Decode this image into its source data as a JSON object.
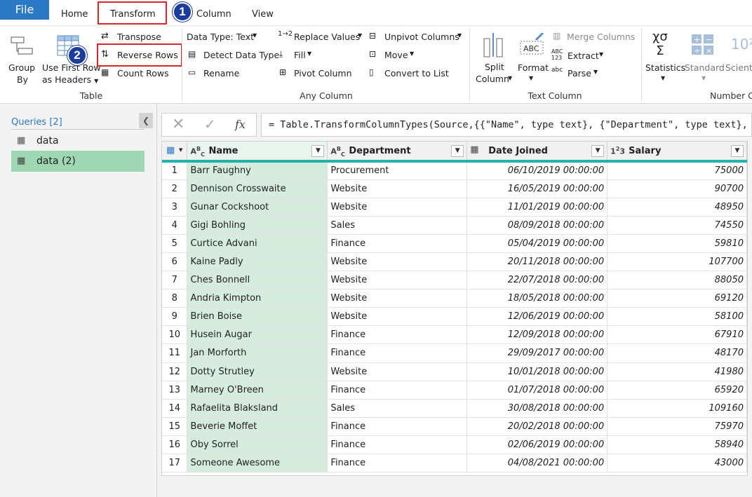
{
  "tabs": {
    "file": "File",
    "home": "Home",
    "transform": "Transform",
    "column": "Column",
    "view": "View"
  },
  "badges": {
    "one": "1",
    "two": "2"
  },
  "ribbon": {
    "group_by_1": "Group",
    "group_by_2": "By",
    "use_first_row_1": "Use First Row",
    "use_first_row_2": "as Headers",
    "transpose": "Transpose",
    "reverse_rows": "Reverse Rows",
    "count_rows": "Count Rows",
    "group_table": "Table",
    "data_type": "Data Type: Text",
    "detect_data_type": "Detect Data Type",
    "rename": "Rename",
    "replace_values": "Replace Values",
    "fill": "Fill",
    "pivot_column": "Pivot Column",
    "unpivot_columns": "Unpivot Columns",
    "move": "Move",
    "convert_to_list": "Convert to List",
    "group_any_column": "Any Column",
    "split_column_1": "Split",
    "split_column_2": "Column",
    "format": "Format",
    "merge_columns": "Merge Columns",
    "extract": "Extract",
    "parse": "Parse",
    "group_text_column": "Text Column",
    "statistics": "Statistics",
    "standard": "Standard",
    "scientific": "Scienti",
    "group_number_column": "Number C"
  },
  "queries": {
    "header": "Queries [2]",
    "items": [
      "data",
      "data (2)"
    ]
  },
  "formula": {
    "fx": "fx",
    "text": "= Table.TransformColumnTypes(Source,{{\"Name\", type text}, {\"Department\", type text},"
  },
  "columns": [
    "Name",
    "Department",
    "Date Joined",
    "Salary"
  ],
  "column_types": [
    "ABC",
    "ABC",
    "date",
    "123"
  ],
  "rows": [
    [
      "1",
      "Barr Faughny",
      "Procurement",
      "06/10/2019 00:00:00",
      "75000"
    ],
    [
      "2",
      "Dennison Crosswaite",
      "Website",
      "16/05/2019 00:00:00",
      "90700"
    ],
    [
      "3",
      "Gunar Cockshoot",
      "Website",
      "11/01/2019 00:00:00",
      "48950"
    ],
    [
      "4",
      "Gigi Bohling",
      "Sales",
      "08/09/2018 00:00:00",
      "74550"
    ],
    [
      "5",
      "Curtice Advani",
      "Finance",
      "05/04/2019 00:00:00",
      "59810"
    ],
    [
      "6",
      "Kaine Padly",
      "Website",
      "20/11/2018 00:00:00",
      "107700"
    ],
    [
      "7",
      "Ches Bonnell",
      "Website",
      "22/07/2018 00:00:00",
      "88050"
    ],
    [
      "8",
      "Andria Kimpton",
      "Website",
      "18/05/2018 00:00:00",
      "69120"
    ],
    [
      "9",
      "Brien Boise",
      "Website",
      "12/06/2019 00:00:00",
      "58100"
    ],
    [
      "10",
      "Husein Augar",
      "Finance",
      "12/09/2018 00:00:00",
      "67910"
    ],
    [
      "11",
      "Jan Morforth",
      "Finance",
      "29/09/2017 00:00:00",
      "48170"
    ],
    [
      "12",
      "Dotty Strutley",
      "Website",
      "10/01/2018 00:00:00",
      "41980"
    ],
    [
      "13",
      "Marney O'Breen",
      "Finance",
      "01/07/2018 00:00:00",
      "65920"
    ],
    [
      "14",
      "Rafaelita Blaksland",
      "Sales",
      "30/08/2018 00:00:00",
      "109160"
    ],
    [
      "15",
      "Beverie Moffet",
      "Finance",
      "20/02/2018 00:00:00",
      "75970"
    ],
    [
      "16",
      "Oby Sorrel",
      "Finance",
      "02/06/2019 00:00:00",
      "58940"
    ],
    [
      "17",
      "Someone Awesome",
      "Finance",
      "04/08/2021 00:00:00",
      "43000"
    ]
  ],
  "colors": {
    "accent": "#2b78c5",
    "highlight": "#d9252a",
    "badge": "#1a3c9c",
    "selected_query": "#9fd6b4",
    "name_column": "#d6ecdf",
    "header_underline": "#22b3a6"
  }
}
